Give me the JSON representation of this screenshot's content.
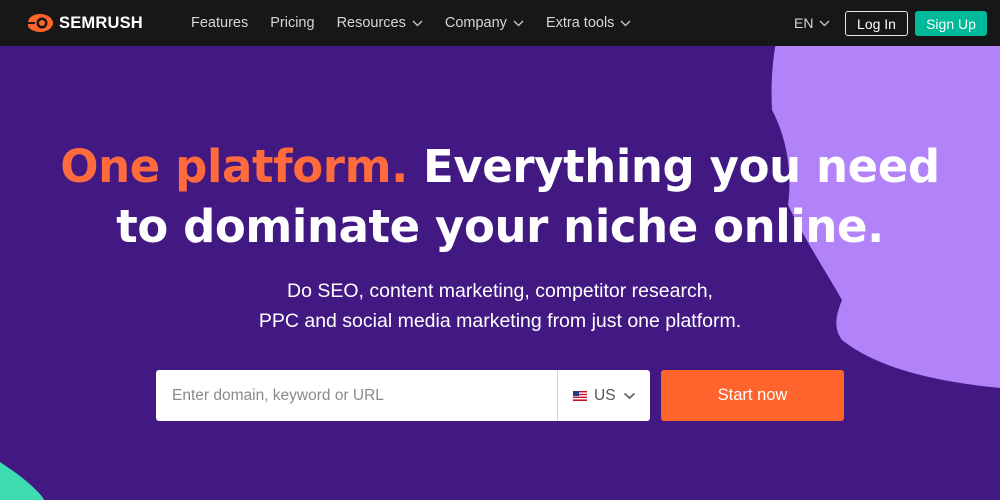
{
  "nav": {
    "logo_text": "SEMRUSH",
    "links": [
      {
        "label": "Features"
      },
      {
        "label": "Pricing"
      },
      {
        "label": "Resources"
      },
      {
        "label": "Company"
      },
      {
        "label": "Extra tools"
      }
    ],
    "language": "EN",
    "login_label": "Log In",
    "signup_label": "Sign Up"
  },
  "hero": {
    "title_accent": "One platform.",
    "title_rest_line1": " Everything you need",
    "title_line2": "to dominate your niche online.",
    "subtitle_line1": "Do SEO, content marketing, competitor research,",
    "subtitle_line2": "PPC and social media marketing from just one platform."
  },
  "search": {
    "placeholder": "Enter domain, keyword or URL",
    "value": "",
    "country": "US",
    "submit_label": "Start now"
  },
  "colors": {
    "background": "#421983",
    "navbar": "#171717",
    "accent_orange": "#ff642d",
    "signup_green": "#00b998",
    "blob_purple": "#b282f9",
    "blob_teal": "#3ddcb1"
  },
  "icons": {
    "logo": "semrush-flame-icon",
    "dropdown": "chevron-down-icon",
    "flag": "us-flag-icon"
  }
}
